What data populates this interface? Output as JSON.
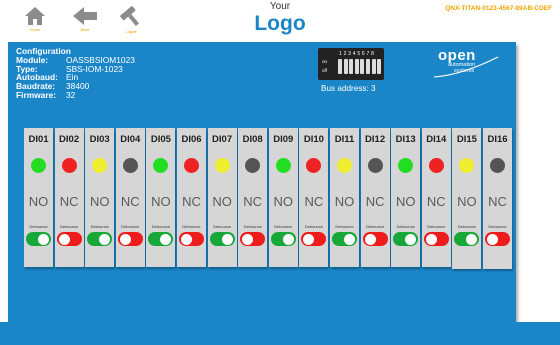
{
  "header": {
    "nav": [
      {
        "label": "Home",
        "icon": "home-icon"
      },
      {
        "label": "Back",
        "icon": "back-arrow-icon"
      },
      {
        "label": "Logoff",
        "icon": "hammer-icon"
      }
    ],
    "logo_small": "Your",
    "logo_big": "Logo",
    "device_id": "QNX-TITAN-0123-4567-89AB-CDEF"
  },
  "config": {
    "title": "Configuration",
    "rows": [
      {
        "label": "Module:",
        "value": "OASSBSIOM1023"
      },
      {
        "label": "Type:",
        "value": "SBS-IOM-1023"
      },
      {
        "label": "Autobaud:",
        "value": "Ein"
      },
      {
        "label": "Baudrate:",
        "value": "38400"
      },
      {
        "label": "Firmware:",
        "value": "32"
      }
    ]
  },
  "dip": {
    "numbers": "12345678",
    "on_label": "on",
    "off_label": "off"
  },
  "bus_address": "Bus address: 3",
  "brand": {
    "open": "open",
    "automation": "automation",
    "systems": "systems"
  },
  "colors": {
    "green": "#22dd22",
    "red": "#ee2222",
    "yellow": "#f0ee30",
    "gray": "#555555",
    "toggle_on": "#18a83a",
    "toggle_off": "#ee1c1c",
    "panel": "#1a86c8"
  },
  "channels": [
    {
      "name": "DI01",
      "led": "green",
      "mode": "NO",
      "debounce": "Debounce",
      "toggle": "on"
    },
    {
      "name": "DI02",
      "led": "red",
      "mode": "NC",
      "debounce": "Debounce",
      "toggle": "off"
    },
    {
      "name": "DI03",
      "led": "yellow",
      "mode": "NO",
      "debounce": "Debounce",
      "toggle": "on"
    },
    {
      "name": "DI04",
      "led": "gray",
      "mode": "NC",
      "debounce": "Debounce",
      "toggle": "off"
    },
    {
      "name": "DI05",
      "led": "green",
      "mode": "NO",
      "debounce": "Debounce",
      "toggle": "on"
    },
    {
      "name": "DI06",
      "led": "red",
      "mode": "NC",
      "debounce": "Debounce",
      "toggle": "off"
    },
    {
      "name": "DI07",
      "led": "yellow",
      "mode": "NO",
      "debounce": "Debounce",
      "toggle": "on"
    },
    {
      "name": "DI08",
      "led": "gray",
      "mode": "NC",
      "debounce": "Debounce",
      "toggle": "off"
    },
    {
      "name": "DI09",
      "led": "green",
      "mode": "NO",
      "debounce": "Debounce",
      "toggle": "on"
    },
    {
      "name": "DI10",
      "led": "red",
      "mode": "NC",
      "debounce": "Debounce",
      "toggle": "off"
    },
    {
      "name": "DI11",
      "led": "yellow",
      "mode": "NO",
      "debounce": "Debounce",
      "toggle": "on"
    },
    {
      "name": "DI12",
      "led": "gray",
      "mode": "NC",
      "debounce": "Debounce",
      "toggle": "off"
    },
    {
      "name": "DI13",
      "led": "green",
      "mode": "NO",
      "debounce": "Debounce",
      "toggle": "on"
    },
    {
      "name": "DI14",
      "led": "red",
      "mode": "NC",
      "debounce": "Debounce",
      "toggle": "off"
    },
    {
      "name": "DI15",
      "led": "yellow",
      "mode": "NO",
      "debounce": "Debounce",
      "toggle": "on"
    },
    {
      "name": "DI16",
      "led": "gray",
      "mode": "NC",
      "debounce": "Debounce",
      "toggle": "off"
    }
  ]
}
